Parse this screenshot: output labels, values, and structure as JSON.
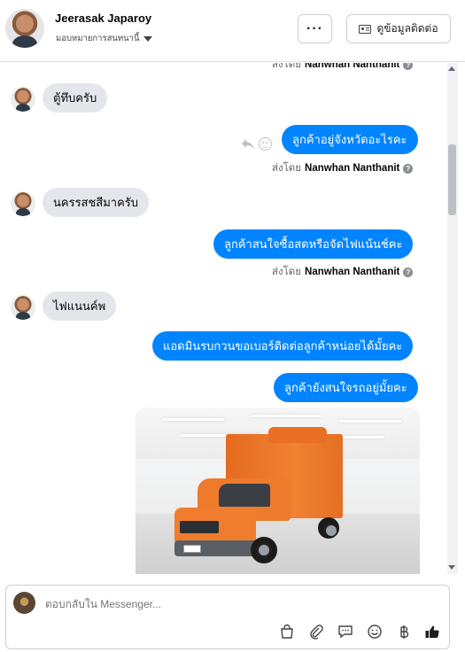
{
  "header": {
    "name": "Jeerasak Japaroy",
    "assign_label": "มอบหมายการสนทนานี้",
    "more_label": "···",
    "contact_label": "ดูข้อมูลติดต่อ"
  },
  "messages": {
    "sent_by_prefix": "ส่งโดย",
    "agent_name": "Nanwhan Nanthanit",
    "top_partial_prefix": "ส่งโดย",
    "top_partial_name": "Nanwhan Nanthanit",
    "in_1": "ตู้ทึบครับ",
    "out_1": "ลูกค้าอยู่จังหวัดอะไรคะ",
    "in_2": "นครรสชสีมาครับ",
    "out_2": "ลูกค้าสนใจซื้อสดหรือจัดไฟแน้นช์คะ",
    "in_3": "ไฟแนนค์พ",
    "out_3": "แอดมินรบกวนขอเบอร์ติดต่อลูกค้าหน่อยได้มั้ยคะ",
    "out_4": "ลูกค้ายังสนใจรถอยู่มั้ยคะ"
  },
  "composer": {
    "placeholder": "ตอบกลับใน Messenger..."
  },
  "icons": {
    "more": "ellipsis-icon",
    "contact": "contact-card-icon",
    "reply": "reply-icon",
    "react": "emoji-react-icon",
    "help": "help-icon",
    "shop": "shopping-bag-icon",
    "attach": "paperclip-icon",
    "saved_replies": "chat-bubble-icon",
    "emoji": "smiley-icon",
    "payment": "baht-icon",
    "like": "thumbs-up-icon"
  },
  "colors": {
    "outgoing_bubble": "#0084ff",
    "incoming_bubble": "#e4e6eb",
    "like": "#1c1e21"
  }
}
